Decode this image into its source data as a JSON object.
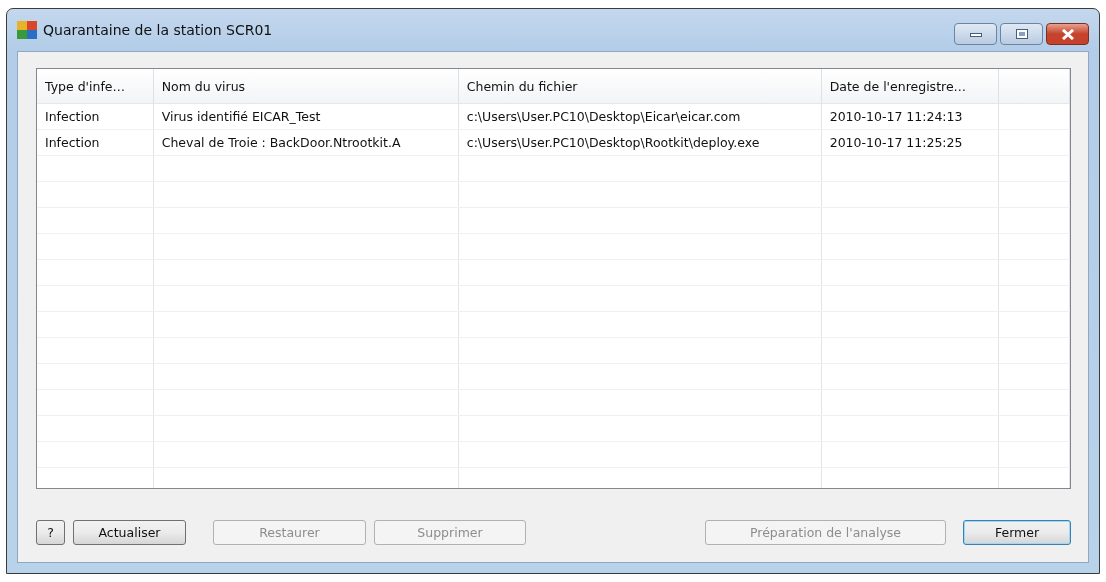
{
  "window": {
    "title": "Quarantaine de la station SCR01"
  },
  "table": {
    "columns": [
      "Type d'infe…",
      "Nom du virus",
      "Chemin du fichier",
      "Date de l'enregistre…"
    ],
    "rows": [
      {
        "cells": [
          "Infection",
          "Virus identifié EICAR_Test",
          "c:\\Users\\User.PC10\\Desktop\\Eicar\\eicar.com",
          "2010-10-17 11:24:13"
        ]
      },
      {
        "cells": [
          "Infection",
          "Cheval de Troie : BackDoor.Ntrootkit.A",
          "c:\\Users\\User.PC10\\Desktop\\Rootkit\\deploy.exe",
          "2010-10-17 11:25:25"
        ]
      }
    ]
  },
  "buttons_left": [
    {
      "label": "?",
      "disabled": false,
      "default": false
    },
    {
      "label": "Actualiser",
      "disabled": false,
      "default": false
    },
    {
      "label": "Restaurer",
      "disabled": true,
      "default": false
    },
    {
      "label": "Supprimer",
      "disabled": true,
      "default": false
    }
  ],
  "buttons_right": [
    {
      "label": "Préparation de l'analyse",
      "disabled": true,
      "default": false
    },
    {
      "label": "Fermer",
      "disabled": false,
      "default": true
    }
  ]
}
